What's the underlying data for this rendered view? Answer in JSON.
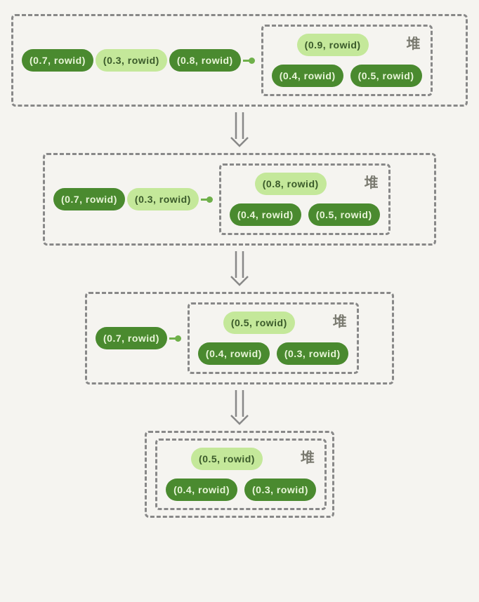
{
  "heapLabel": "堆",
  "steps": [
    {
      "queue": [
        {
          "label": "(0.7, rowid)",
          "style": "dark"
        },
        {
          "label": "(0.3, rowid)",
          "style": "light"
        },
        {
          "label": "(0.8, rowid)",
          "style": "dark"
        }
      ],
      "heapTop": {
        "label": "(0.9, rowid)",
        "style": "light"
      },
      "heapBottom": [
        {
          "label": "(0.4, rowid)",
          "style": "dark"
        },
        {
          "label": "(0.5, rowid)",
          "style": "dark"
        }
      ]
    },
    {
      "queue": [
        {
          "label": "(0.7, rowid)",
          "style": "dark"
        },
        {
          "label": "(0.3, rowid)",
          "style": "light"
        }
      ],
      "heapTop": {
        "label": "(0.8, rowid)",
        "style": "light"
      },
      "heapBottom": [
        {
          "label": "(0.4, rowid)",
          "style": "dark"
        },
        {
          "label": "(0.5, rowid)",
          "style": "dark"
        }
      ]
    },
    {
      "queue": [
        {
          "label": "(0.7, rowid)",
          "style": "dark"
        }
      ],
      "heapTop": {
        "label": "(0.5, rowid)",
        "style": "light"
      },
      "heapBottom": [
        {
          "label": "(0.4, rowid)",
          "style": "dark"
        },
        {
          "label": "(0.3, rowid)",
          "style": "dark"
        }
      ]
    },
    {
      "queue": [],
      "heapTop": {
        "label": "(0.5, rowid)",
        "style": "light"
      },
      "heapBottom": [
        {
          "label": "(0.4, rowid)",
          "style": "dark"
        },
        {
          "label": "(0.3, rowid)",
          "style": "dark"
        }
      ]
    }
  ]
}
